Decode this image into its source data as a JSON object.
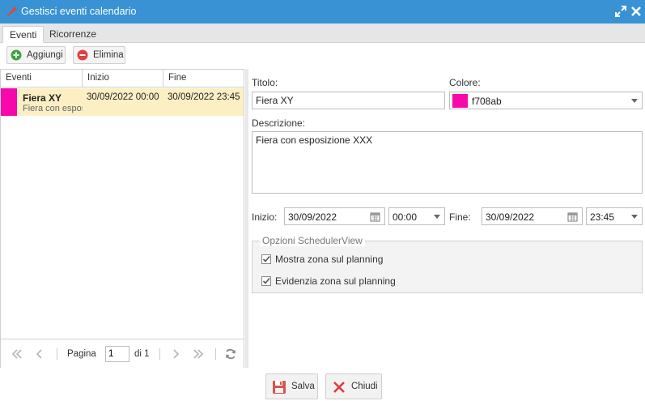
{
  "window": {
    "title": "Gestisci eventi calendario",
    "app_icon": "pin-icon",
    "maximize_icon": "maximize-icon",
    "close_icon": "close-icon",
    "accent_color": "#3892d4"
  },
  "tabs": [
    {
      "label": "Eventi",
      "active": true
    },
    {
      "label": "Ricorrenze",
      "active": false
    }
  ],
  "toolbar": {
    "add_label": "Aggiungi",
    "add_icon": "plus-circle-icon",
    "delete_label": "Elimina",
    "delete_icon": "minus-circle-icon"
  },
  "grid": {
    "columns": [
      "Eventi",
      "Inizio",
      "Fine"
    ],
    "rows": [
      {
        "color": "#f708ab",
        "title": "Fiera XY",
        "subtitle": "Fiera con esposizione XXX",
        "start": "30/09/2022 00:00",
        "end": "30/09/2022 23:45",
        "selected": true
      }
    ],
    "pager": {
      "page_label": "Pagina",
      "page_value": "1",
      "of_label": "di 1"
    }
  },
  "form": {
    "title_label": "Titolo:",
    "title_value": "Fiera XY",
    "color_label": "Colore:",
    "color_value": "f708ab",
    "color_hex": "#f708ab",
    "description_label": "Descrizione:",
    "description_value": "Fiera con esposizione XXX",
    "start_label": "Inizio:",
    "start_date": "30/09/2022",
    "start_time": "00:00",
    "end_label": "Fine:",
    "end_date": "30/09/2022",
    "end_time": "23:45",
    "options_legend": "Opzioni SchedulerView",
    "option_show": "Mostra zona sul planning",
    "option_highlight": "Evidenzia zona sul planning",
    "option_show_checked": true,
    "option_highlight_checked": true
  },
  "footer": {
    "save_label": "Salva",
    "save_icon": "floppy-disk-icon",
    "close_label": "Chiudi",
    "close_icon": "x-icon"
  }
}
